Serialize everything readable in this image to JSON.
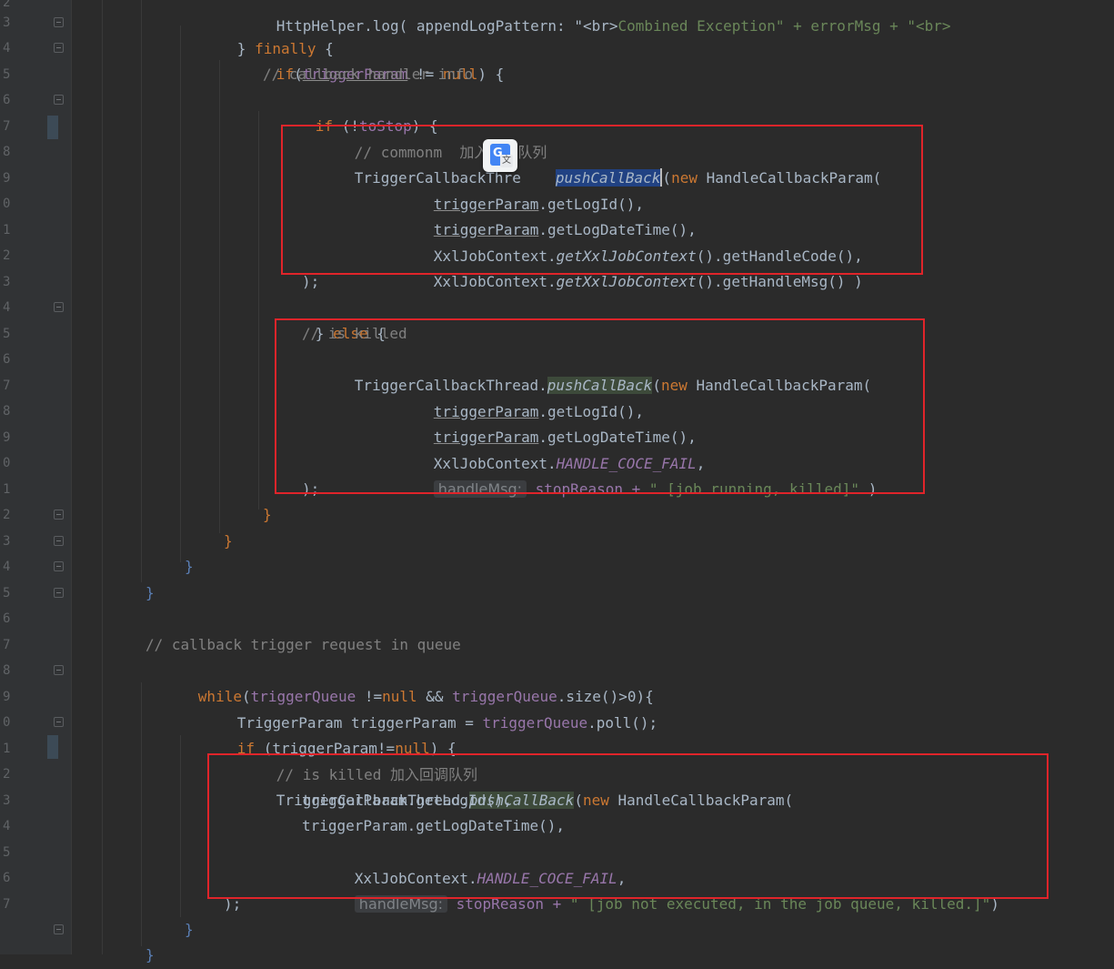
{
  "gutter": {
    "line_numbers": [
      "2",
      "3",
      "4",
      "5",
      "6",
      "7",
      "8",
      "9",
      "0",
      "1",
      "2",
      "3",
      "4",
      "5",
      "6",
      "7",
      "8",
      "9",
      "0",
      "1",
      "2",
      "3",
      "4",
      "5",
      "6",
      "7",
      "8",
      "9",
      "0",
      "1",
      "2",
      "3",
      "4",
      "5",
      "6",
      "7"
    ]
  },
  "code": {
    "l00_a": "HttpHelper.log( appendLogPattern: \"<br>",
    "l00_b": "Combined Exception",
    "l00_c": "\" + errorMsg + \"<br>",
    "l01_a": "} ",
    "l01_b": "finally",
    "l01_c": " {",
    "l02_a": "if",
    "l02_b": "(",
    "l02_c": "triggerParam",
    "l02_d": " != ",
    "l02_e": "null",
    "l02_f": ") {",
    "l03": "// callback handler info",
    "l04_a": "if",
    "l04_b": " (!",
    "l04_c": "toStop",
    "l04_d": ") {",
    "l05_a": "// commonm  ",
    "l05_b": "加入回调队列",
    "l06_a": "TriggerCallbackThre",
    "l06_b": "pushCallBack",
    "l06_c": "(",
    "l06_d": "new",
    "l06_e": " HandleCallbackParam(",
    "l07_a": "triggerParam",
    "l07_b": ".getLogId(),",
    "l08_a": "triggerParam",
    "l08_b": ".getLogDateTime(),",
    "l09_a": "XxlJobContext.",
    "l09_b": "getXxlJobContext",
    "l09_c": "().getHandleCode(),",
    "l10_a": "XxlJobContext.",
    "l10_b": "getXxlJobContext",
    "l10_c": "().getHandleMsg() )",
    "l11": ");",
    "l12_a": "} ",
    "l12_b": "else",
    "l12_c": " {",
    "l13": "// is killed",
    "l14_a": "TriggerCallbackThread.",
    "l14_b": "pushCallBack",
    "l14_c": "(",
    "l14_d": "new",
    "l14_e": " HandleCallbackParam(",
    "l15_a": "triggerParam",
    "l15_b": ".getLogId(),",
    "l16_a": "triggerParam",
    "l16_b": ".getLogDateTime(),",
    "l17_a": "XxlJobContext.",
    "l17_b": "HANDLE_COCE_FAIL",
    "l17_c": ",",
    "l18_hint": "handleMsg:",
    "l18_a": " stopReason + ",
    "l18_b": "\" [job running, killed]\"",
    "l18_c": " )",
    "l19": ");",
    "l20": "}",
    "l21": "}",
    "l22": "}",
    "l23": "}",
    "l25": "// callback trigger request in queue",
    "l26_a": "while",
    "l26_b": "(",
    "l26_c": "triggerQueue",
    "l26_d": " !=",
    "l26_e": "null",
    "l26_f": " && ",
    "l26_g": "triggerQueue",
    "l26_h": ".size()>0){",
    "l27_a": "TriggerParam triggerParam = ",
    "l27_b": "triggerQueue",
    "l27_c": ".poll();",
    "l28_a": "if",
    "l28_b": " (triggerParam!=",
    "l28_c": "null",
    "l28_d": ") {",
    "l29_a": "// is killed ",
    "l29_b": "加入回调队列",
    "l30_a": "TriggerCallbackThread.",
    "l30_b": "pushCallBack",
    "l30_c": "(",
    "l30_d": "new",
    "l30_e": " HandleCallbackParam(",
    "l31": "triggerParam.getLogId(),",
    "l32": "triggerParam.getLogDateTime(),",
    "l33_a": "XxlJobContext.",
    "l33_b": "HANDLE_COCE_FAIL",
    "l33_c": ",",
    "l34_hint": "handleMsg:",
    "l34_a": " stopReason + ",
    "l34_b": "\" [job not executed, in the job queue, killed.]\"",
    "l34_c": ")",
    "l35": ");",
    "l36": "}",
    "l37": "}"
  }
}
